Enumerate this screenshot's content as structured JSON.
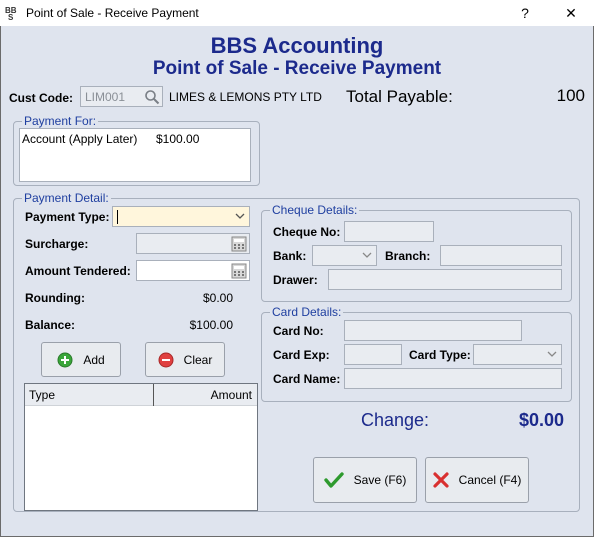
{
  "window": {
    "title": "Point of Sale - Receive Payment",
    "help": "?",
    "close": "✕"
  },
  "header": {
    "company": "BBS Accounting",
    "subtitle": "Point of Sale - Receive Payment"
  },
  "customer": {
    "code_label": "Cust Code:",
    "code_value": "LIM001",
    "name": "LIMES & LEMONS PTY LTD",
    "total_payable_label": "Total Payable:",
    "total_payable_value": "100"
  },
  "payment_for": {
    "title": "Payment For:",
    "items": [
      {
        "description": "Account (Apply Later)",
        "amount": "$100.00"
      }
    ]
  },
  "payment_detail": {
    "title": "Payment Detail:",
    "payment_type_label": "Payment Type:",
    "payment_type_value": "",
    "surcharge_label": "Surcharge:",
    "amount_tendered_label": "Amount Tendered:",
    "rounding_label": "Rounding:",
    "rounding_value": "$0.00",
    "balance_label": "Balance:",
    "balance_value": "$100.00",
    "add_label": "Add",
    "clear_label": "Clear",
    "grid_columns": [
      "Type",
      "Amount"
    ]
  },
  "cheque": {
    "title": "Cheque Details:",
    "cheque_no_label": "Cheque No:",
    "bank_label": "Bank:",
    "branch_label": "Branch:",
    "drawer_label": "Drawer:"
  },
  "card": {
    "title": "Card Details:",
    "card_no_label": "Card No:",
    "card_exp_label": "Card Exp:",
    "card_type_label": "Card Type:",
    "card_name_label": "Card Name:"
  },
  "change": {
    "label": "Change:",
    "value": "$0.00"
  },
  "actions": {
    "save_label": "Save (F6)",
    "cancel_label": "Cancel (F4)"
  },
  "colors": {
    "accent": "#1c2a8c",
    "group_title": "#1f3fa0",
    "background": "#dfe4ee"
  }
}
